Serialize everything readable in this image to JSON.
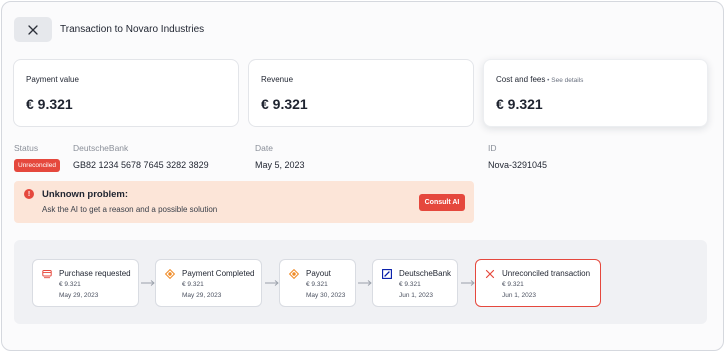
{
  "header": {
    "title": "Transaction to Novaro Industries"
  },
  "cards": [
    {
      "label": "Payment value",
      "value": "€ 9.321"
    },
    {
      "label": "Revenue",
      "value": "€ 9.321"
    },
    {
      "label": "Cost and fees",
      "link": "See details",
      "separator": " • ",
      "value": "€ 9.321"
    }
  ],
  "info": {
    "status_label": "Status",
    "status_value": "Unreconciled",
    "bank_label": "DeutscheBank",
    "bank_value": "GB82 1234 5678 7645 3282 3829",
    "date_label": "Date",
    "date_value": "May 5, 2023",
    "id_label": "ID",
    "id_value": "Nova-3291045"
  },
  "alert": {
    "title": "Unknown problem:",
    "text": "Ask the AI to get a reason and a possible solution",
    "button": "Consult AI",
    "icon": "!"
  },
  "timeline": [
    {
      "title": "Purchase requested",
      "amount": "€ 9.321",
      "date": "May 29, 2023",
      "icon": "card-icon"
    },
    {
      "title": "Payment Completed",
      "amount": "€ 9.321",
      "date": "May 29, 2023",
      "icon": "coin-icon"
    },
    {
      "title": "Payout",
      "amount": "€ 9.321",
      "date": "May 30, 2023",
      "icon": "coin-icon"
    },
    {
      "title": "DeutscheBank",
      "amount": "€ 9.321",
      "date": "Jun 1, 2023",
      "icon": "deutschebank-logo-icon"
    },
    {
      "title": "Unreconciled transaction",
      "amount": "€ 9.321",
      "date": "Jun 1, 2023",
      "icon": "x-icon"
    }
  ],
  "colors": {
    "accent_red": "#e5483d",
    "alert_bg": "#fce5d8",
    "coin_orange": "#f08a24",
    "bank_blue": "#0018a8"
  }
}
